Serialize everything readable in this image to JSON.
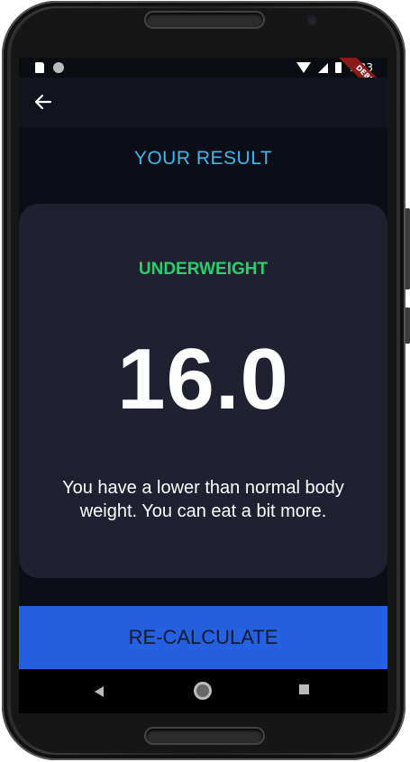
{
  "status_bar": {
    "time": "7:23"
  },
  "debug_banner": "DEBUG",
  "page": {
    "title": "YOUR RESULT"
  },
  "result": {
    "status": "UNDERWEIGHT",
    "bmi_value": "16.0",
    "message": "You have a lower than normal body weight. You can eat a bit more."
  },
  "action": {
    "recalculate_label": "RE-CALCULATE"
  },
  "colors": {
    "background": "#0b0d17",
    "card": "#1f2130",
    "title": "#41b6ea",
    "status": "#25d26a",
    "button": "#2460df"
  }
}
